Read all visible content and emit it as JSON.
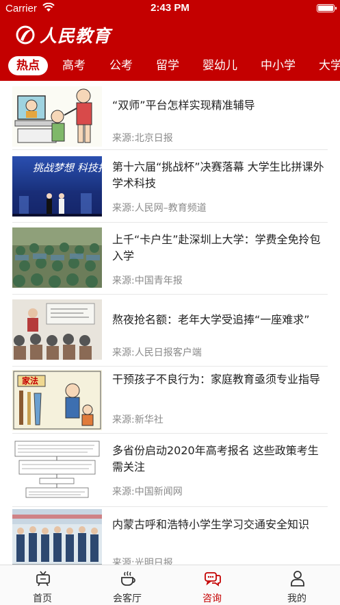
{
  "status_bar": {
    "carrier": "Carrier",
    "time": "2:43 PM"
  },
  "app": {
    "logo_text": "人民教育",
    "brand_color": "#c40000"
  },
  "tabs": [
    {
      "label": "热点",
      "active": true
    },
    {
      "label": "高考"
    },
    {
      "label": "公考"
    },
    {
      "label": "留学"
    },
    {
      "label": "婴幼儿"
    },
    {
      "label": "中小学"
    },
    {
      "label": "大学"
    }
  ],
  "articles": [
    {
      "title": "“双师”平台怎样实现精准辅导",
      "source": "来源:北京日报"
    },
    {
      "title": "第十六届“挑战杯”决赛落幕 大学生比拼课外学术科技",
      "source": "来源:人民网–教育频道"
    },
    {
      "title": "上千“卡户生”赴深圳上大学：学费全免拎包入学",
      "source": "来源:中国青年报"
    },
    {
      "title": "熬夜抢名额：老年大学受追捧“一座难求”",
      "source": "来源:人民日报客户端"
    },
    {
      "title": "干预孩子不良行为：家庭教育亟须专业指导",
      "source": "来源:新华社"
    },
    {
      "title": "多省份启动2020年高考报名 这些政策考生需关注",
      "source": "来源:中国新闻网"
    },
    {
      "title": "内蒙古呼和浩特小学生学习交通安全知识",
      "source": "来源:光明日报"
    }
  ],
  "thumb_texts": {
    "challenge_slogan": "挑战梦想 科技报国",
    "family_rules": "家法"
  },
  "bottom_nav": [
    {
      "label": "首页",
      "icon": "home-tv-icon"
    },
    {
      "label": "会客厅",
      "icon": "coffee-cup-icon"
    },
    {
      "label": "咨询",
      "icon": "chat-bubbles-icon",
      "active": true
    },
    {
      "label": "我的",
      "icon": "person-icon"
    }
  ]
}
